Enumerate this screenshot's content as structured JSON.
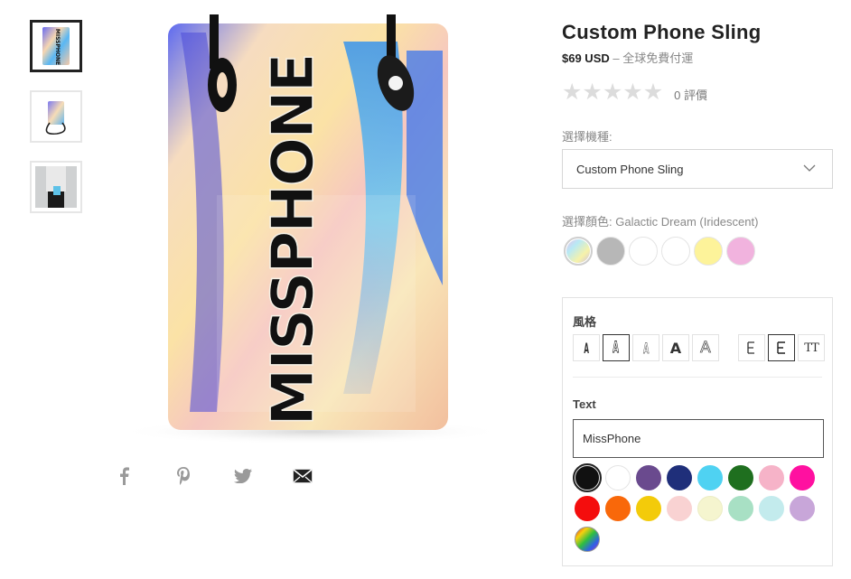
{
  "thumbnails": [
    {
      "name": "front view"
    },
    {
      "name": "with strap"
    },
    {
      "name": "worn by model"
    }
  ],
  "product": {
    "title": "Custom Phone Sling",
    "price": "$69 USD",
    "shipping": " – 全球免費付運",
    "rating_stars": 0,
    "reviews": "0 評價",
    "image_text": "MISSPHONE"
  },
  "model": {
    "label": "選擇機種:",
    "selected": "Custom Phone Sling"
  },
  "color": {
    "label": "選擇顏色: Galactic Dream (Iridescent)",
    "swatches": [
      "#c9b8f0",
      "#b7b7b7",
      "#ffffff",
      "#ffffff",
      "#fdf39a",
      "#f1b3de"
    ]
  },
  "custom": {
    "style_label": "風格",
    "text_label": "Text",
    "text_value": "MissPhone",
    "text_colors": [
      "#111111",
      "#ffffff",
      "#6a4a8e",
      "#1f2f7a",
      "#4fd2f2",
      "#1f6f1f",
      "#f6b3c8",
      "#ff10a0",
      "#f40d0d",
      "#f9680a",
      "#f3cb0a",
      "#f9d2d2",
      "#f5f5cf",
      "#a8e0c4",
      "#c3ebed",
      "#c8a6d9",
      "rainbow"
    ]
  }
}
